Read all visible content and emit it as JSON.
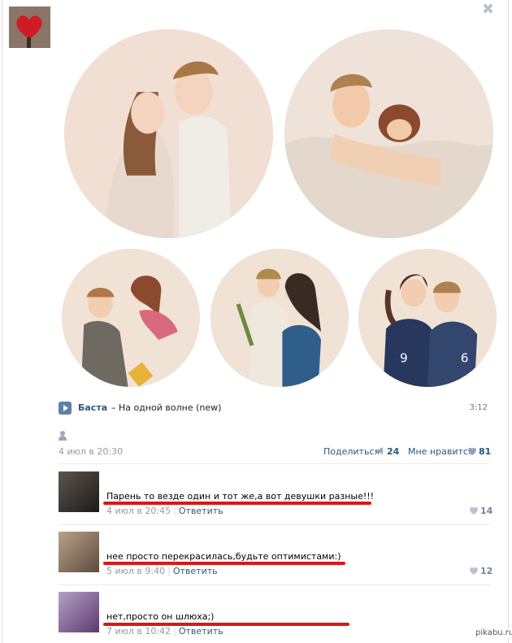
{
  "audio": {
    "artist": "Баста",
    "title": "– На одной волне (new)",
    "duration": "3:12"
  },
  "post": {
    "date": "4 июл в 20:30",
    "share_label": "Поделиться",
    "share_count": "24",
    "like_label": "Мне нравится",
    "like_count": "81"
  },
  "comments": [
    {
      "text": "Парень то везде один и тот же,а вот девушки разные!!!",
      "date": "4 июл в 20:45",
      "reply": "Ответить",
      "likes": "14"
    },
    {
      "text": "нее просто перекрасилась,будьте оптимистами:)",
      "date": "5 июл в 9:40",
      "reply": "Ответить",
      "likes": "12"
    },
    {
      "text": "нет,просто он шлюха;)",
      "date": "7 июл в 10:42",
      "reply": "Ответить",
      "likes": ""
    }
  ],
  "watermark": "pikabu.ru",
  "colors": {
    "link": "#2b587a",
    "muted": "#999999",
    "highlight_red": "#d81818",
    "illustration_bg": "#f1ddd2"
  },
  "icons": [
    "close-icon",
    "play-icon",
    "person-icon",
    "megaphone-icon",
    "heart-icon"
  ]
}
